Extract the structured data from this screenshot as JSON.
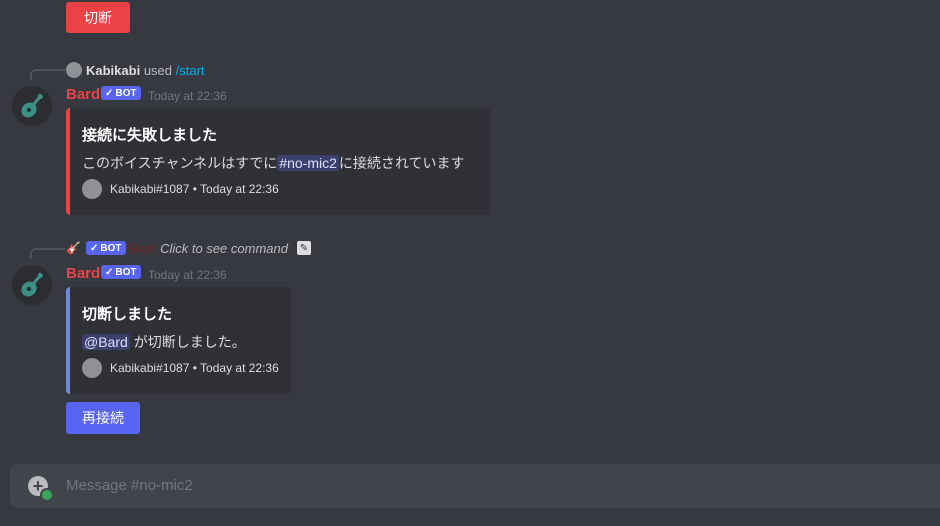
{
  "top_button": {
    "label": "切断"
  },
  "message1": {
    "reply": {
      "user": "Kabikabi",
      "verb": "used",
      "command": "/start"
    },
    "author": "Bard",
    "bot_tag": "BOT",
    "timestamp": "Today at 22:36",
    "embed": {
      "title": "接続に失敗しました",
      "desc_before": "このボイスチャンネルはすでに",
      "channel": "no-mic2",
      "desc_after": "に接続されています",
      "footer": "Kabikabi#1087 • Today at 22:36",
      "bar_color": "#ed4245"
    }
  },
  "message2": {
    "reply": {
      "bot_tag": "BOT",
      "author_faded": "Bard",
      "hint": "Click to see command"
    },
    "author": "Bard",
    "bot_tag": "BOT",
    "timestamp": "Today at 22:36",
    "embed": {
      "title": "切断しました",
      "mention": "@Bard",
      "desc_after": "が切断しました。",
      "footer": "Kabikabi#1087 • Today at 22:36",
      "bar_color": "#7289da"
    },
    "button": {
      "label": "再接続"
    }
  },
  "composer": {
    "placeholder": "Message #no-mic2"
  },
  "colors": {
    "background": "#36393f",
    "accent": "#5865f2",
    "danger": "#ed4245"
  }
}
